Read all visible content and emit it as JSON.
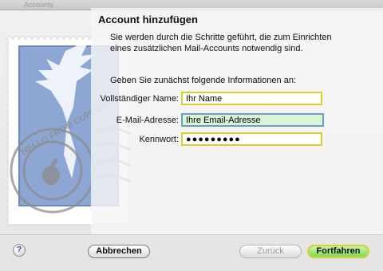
{
  "window": {
    "ghost_tab": "Accounts"
  },
  "dialog": {
    "title": "Account hinzufügen",
    "intro": "Sie werden durch die Schritte geführt, die zum Einrichten eines zusätzlichen Mail-Accounts notwendig sind.",
    "prompt": "Geben Sie zunächst folgende Informationen an:"
  },
  "form": {
    "full_name_label": "Vollständiger Name:",
    "full_name_value": "Ihr Name",
    "email_label": "E-Mail-Adresse:",
    "email_value": "Ihre Email-Adresse",
    "password_label": "Kennwort:",
    "password_value": "●●●●●●●●●"
  },
  "buttons": {
    "help": "?",
    "cancel": "Abbrechen",
    "back": "Zurück",
    "continue": "Fortfahren"
  },
  "stamp": {
    "postmark_text": "HELLO FROM CUPERTINO"
  },
  "colors": {
    "highlight_border": "#d9d12a",
    "focus_fill": "#d8f6d6",
    "primary_button": "#7ddc5a",
    "stamp_blue": "#8ea6d4"
  }
}
